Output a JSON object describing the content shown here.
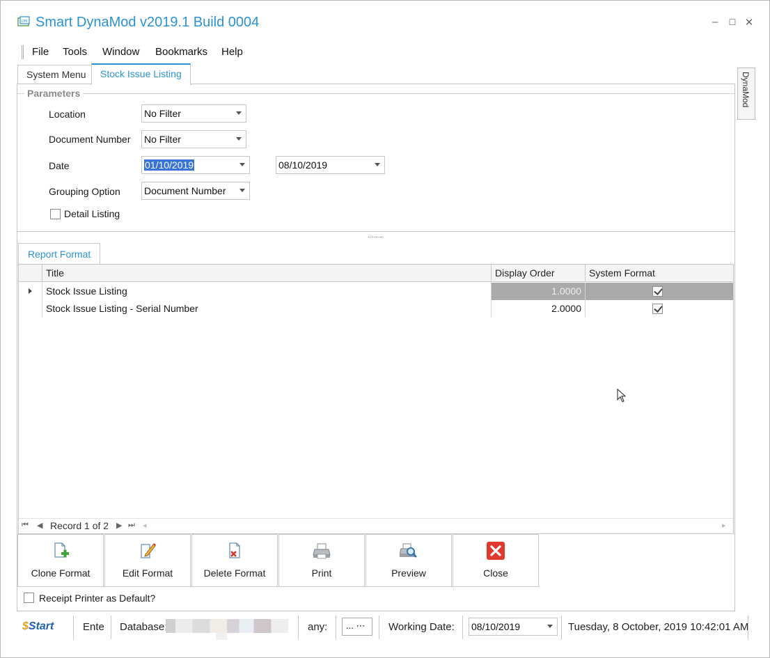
{
  "app": {
    "title": "Smart DynaMod v2019.1 Build 0004",
    "window_controls": {
      "minimize": "–",
      "maximize": "☐",
      "close": "✕"
    }
  },
  "menu": [
    "File",
    "Tools",
    "Window",
    "Bookmarks",
    "Help"
  ],
  "tabs": [
    {
      "label": "System Menu",
      "active": false
    },
    {
      "label": "Stock Issue Listing",
      "active": true
    }
  ],
  "side_tab": {
    "label": "DynaMod"
  },
  "parameters": {
    "title": "Parameters",
    "location": {
      "label": "Location",
      "value": "No Filter"
    },
    "document_number": {
      "label": "Document Number",
      "value": "No Filter"
    },
    "date": {
      "label": "Date",
      "from": "01/10/2019",
      "to": "08/10/2019"
    },
    "grouping_option": {
      "label": "Grouping Option",
      "value": "Document Number"
    },
    "detail_listing": {
      "label": "Detail Listing",
      "checked": false
    }
  },
  "report_format": {
    "tab_label": "Report Format",
    "columns": {
      "title": "Title",
      "display_order": "Display Order",
      "system_format": "System Format"
    },
    "rows": [
      {
        "title": "Stock Issue Listing",
        "display_order": "1.0000",
        "system_format": true,
        "selected": true
      },
      {
        "title": "Stock Issue Listing - Serial Number",
        "display_order": "2.0000",
        "system_format": true,
        "selected": false
      }
    ],
    "navigator": {
      "record_text": "Record 1 of 2"
    }
  },
  "commands": {
    "clone_format": "Clone Format",
    "edit_format": "Edit Format",
    "delete_format": "Delete Format",
    "print": "Print",
    "preview": "Preview",
    "close": "Close"
  },
  "receipt_printer": {
    "label": "Receipt Printer as Default?",
    "checked": false
  },
  "status_bar": {
    "logo": "Start",
    "ente": "Ente",
    "database_label": "Database:",
    "company_label": "any:",
    "company_button": "... ⋯",
    "working_date_label": "Working Date:",
    "working_date_value": "08/10/2019",
    "datetime": "Tuesday, 8 October, 2019 10:42:01 AM"
  },
  "colors": {
    "accent": "#2a93d5",
    "selection": "#3874d8",
    "grid_selected": "#a9a9a9",
    "close_red": "#e03a2f"
  }
}
